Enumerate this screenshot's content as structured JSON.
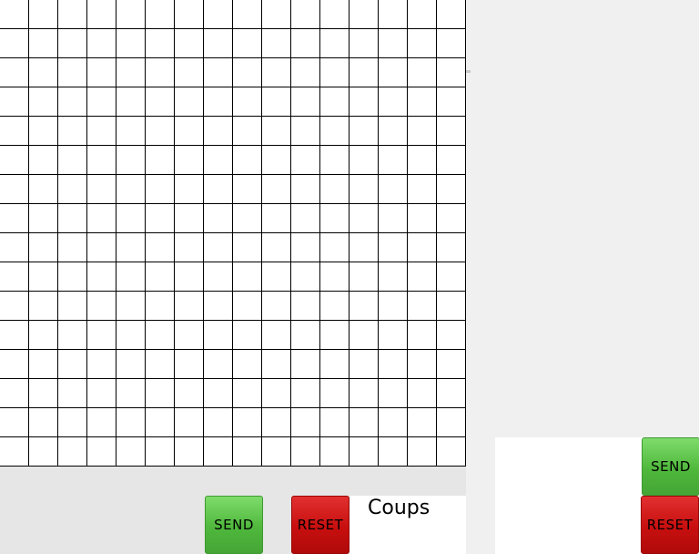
{
  "board": {
    "rows": 16,
    "cols": 16
  },
  "bottom_controls": {
    "send_label": "SEND",
    "reset_label": "RESET",
    "coups_label": "Coups"
  },
  "side_controls": {
    "send_label": "SEND",
    "reset_label": "RESET"
  },
  "colors": {
    "send_green": "#4fb83c",
    "reset_red": "#c80f0f",
    "grid_line": "#000000",
    "background": "#f0f0f0"
  }
}
